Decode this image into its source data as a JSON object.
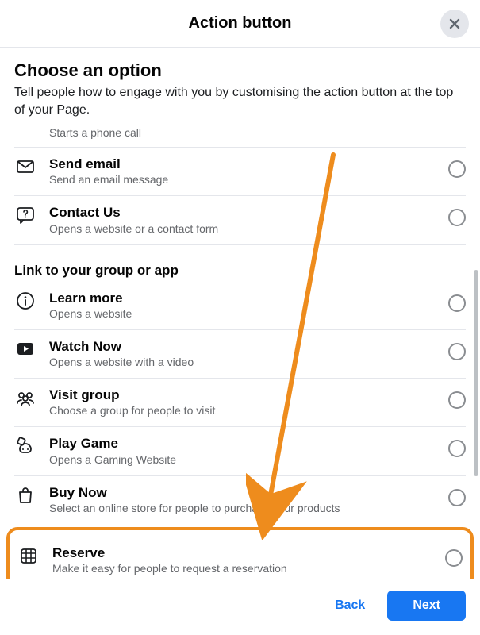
{
  "header": {
    "title": "Action button"
  },
  "choose": {
    "title": "Choose an option",
    "subtitle": "Tell people how to engage with you by customising the action button at the top of your Page.",
    "partial_item_sub": "Starts a phone call"
  },
  "section1": {
    "items": [
      {
        "title": "Send email",
        "sub": "Send an email message",
        "icon": "mail"
      },
      {
        "title": "Contact Us",
        "sub": "Opens a website or a contact form",
        "icon": "question"
      }
    ]
  },
  "section2": {
    "title": "Link to your group or app",
    "items": [
      {
        "title": "Learn more",
        "sub": "Opens a website",
        "icon": "info"
      },
      {
        "title": "Watch Now",
        "sub": "Opens a website with a video",
        "icon": "play"
      },
      {
        "title": "Visit group",
        "sub": "Choose a group for people to visit",
        "icon": "group"
      },
      {
        "title": "Play Game",
        "sub": "Opens a Gaming Website",
        "icon": "game"
      },
      {
        "title": "Buy Now",
        "sub": "Select an online store for people to purchase your products",
        "icon": "bag"
      },
      {
        "title": "Reserve",
        "sub": "Make it easy for people to request a reservation",
        "icon": "calendar"
      }
    ]
  },
  "footer": {
    "back": "Back",
    "next": "Next"
  },
  "highlight_color": "#ee8c1d"
}
